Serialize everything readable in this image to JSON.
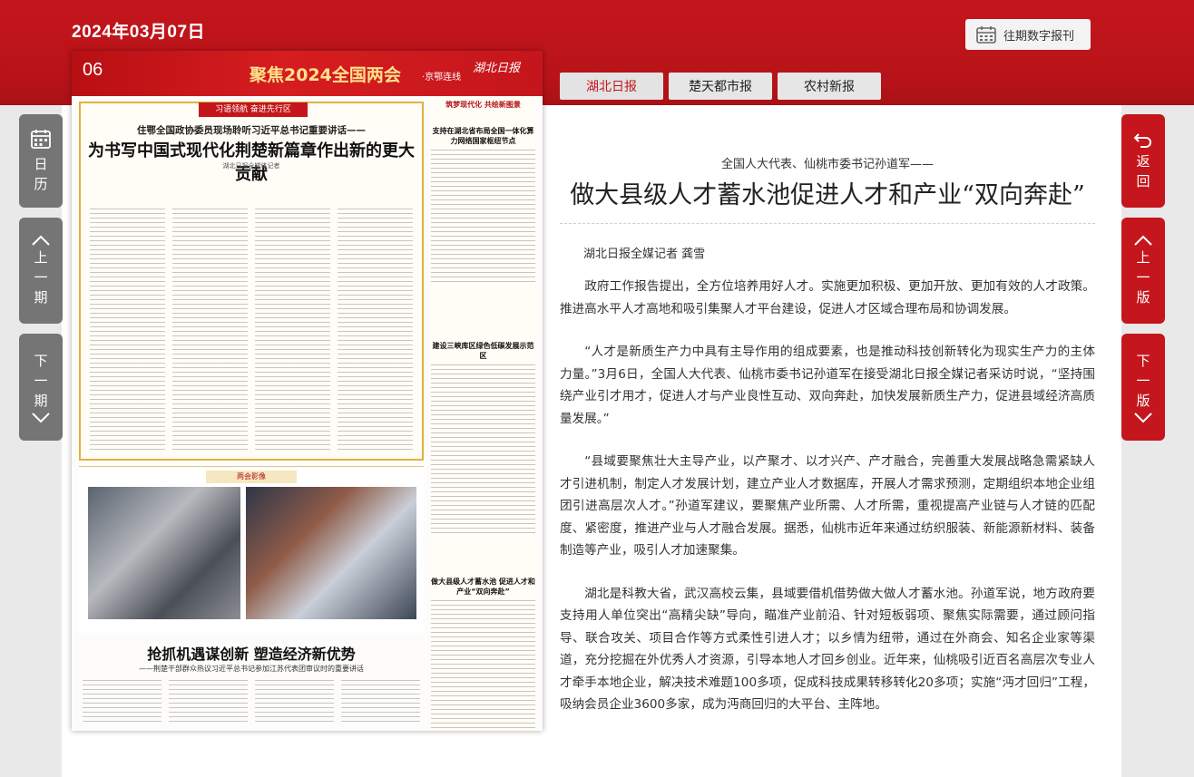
{
  "header": {
    "date": "2024年03月07日",
    "archive_label": "往期数字报刊"
  },
  "nav": {
    "calendar_label": "日历",
    "prev_issue_label": "上一期",
    "next_issue_label": "下一期",
    "back_label": "返回",
    "prev_page_label": "上一版",
    "next_page_label": "下一版"
  },
  "tabs": [
    {
      "label": "湖北日报",
      "active": true
    },
    {
      "label": "楚天都市报",
      "active": false
    },
    {
      "label": "农村新报",
      "active": false
    }
  ],
  "newspaper": {
    "page_number": "06",
    "banner": "聚焦2024全国两会",
    "banner_sub": "·京鄂连线",
    "logo": "湖北日报",
    "main_ribbon": "习语领航 奋进先行区",
    "main_kicker": "住鄂全国政协委员现场聆听习近平总书记重要讲话——",
    "main_title": "为书写中国式现代化荆楚新篇章作出新的更大贡献",
    "main_credit": "湖北日报全媒体记者",
    "photo_label": "两会影像",
    "second_title": "抢抓机遇谋创新 塑造经济新优势",
    "second_sub": "——荆楚干部群众热议习近平总书记参加江苏代表团审议时的重要讲话",
    "right_heads": [
      "筑梦现代化 共绘新图景",
      "支持在湖北省布局全国一体化算力网络国家枢纽节点",
      "建设三峡库区绿色低碳发展示范区",
      "做大县级人才蓄水池 促进人才和产业“双向奔赴”"
    ]
  },
  "article": {
    "kicker": "全国人大代表、仙桃市委书记孙道军——",
    "title": "做大县级人才蓄水池促进人才和产业“双向奔赴”",
    "byline": "湖北日报全媒记者 龚雪",
    "paragraphs": [
      "政府工作报告提出，全方位培养用好人才。实施更加积极、更加开放、更加有效的人才政策。推进高水平人才高地和吸引集聚人才平台建设，促进人才区域合理布局和协调发展。",
      "“人才是新质生产力中具有主导作用的组成要素，也是推动科技创新转化为现实生产力的主体力量。”3月6日，全国人大代表、仙桃市委书记孙道军在接受湖北日报全媒记者采访时说，“坚持围绕产业引才用才，促进人才与产业良性互动、双向奔赴，加快发展新质生产力，促进县域经济高质量发展。”",
      "“县域要聚焦壮大主导产业，以产聚才、以才兴产、产才融合，完善重大发展战略急需紧缺人才引进机制，制定人才发展计划，建立产业人才数据库，开展人才需求预测，定期组织本地企业组团引进高层次人才。”孙道军建议，要聚焦产业所需、人才所需，重视提高产业链与人才链的匹配度、紧密度，推进产业与人才融合发展。据悉，仙桃市近年来通过纺织服装、新能源新材料、装备制造等产业，吸引人才加速聚集。",
      "湖北是科教大省，武汉高校云集，县域要借机借势做大做人才蓄水池。孙道军说，地方政府要支持用人单位突出“高精尖缺”导向，瞄准产业前沿、针对短板弱项、聚焦实际需要，通过顾问指导、联合攻关、项目合作等方式柔性引进人才；以乡情为纽带，通过在外商会、知名企业家等渠道，充分挖掘在外优秀人才资源，引导本地人才回乡创业。近年来，仙桃吸引近百名高层次专业人才牵手本地企业，解决技术难题100多项，促成科技成果转移转化20多项；实施“沔才回归”工程，吸纳会员企业3600多家，成为沔商回归的大平台、主阵地。"
    ]
  },
  "colors": {
    "brand_red": "#c4161c",
    "nav_grey": "#757575",
    "banner_gold": "#ffe08a"
  }
}
